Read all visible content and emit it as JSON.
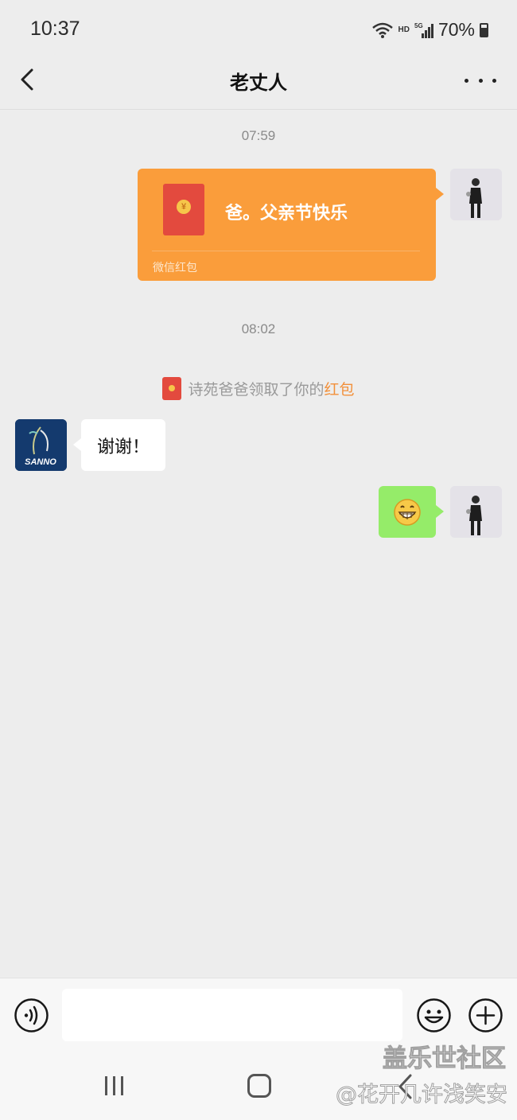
{
  "status_bar": {
    "time": "10:37",
    "network": "HD",
    "signal": "5G",
    "battery": "70%"
  },
  "header": {
    "title": "老丈人"
  },
  "messages": {
    "time_1": "07:59",
    "red_packet": {
      "message": "爸。父亲节快乐",
      "label": "微信红包",
      "coin_symbol": "¥"
    },
    "time_2": "08:02",
    "system_notice": {
      "text": "诗苑爸爸领取了你的",
      "link": "红包"
    },
    "reply_text": "谢谢！",
    "avatar_other_logo": "SANNO"
  },
  "input_bar": {
    "placeholder": ""
  },
  "watermark": {
    "title": "盖乐世社区",
    "user": "@花开几许浅笑安"
  },
  "colors": {
    "background": "#ededed",
    "red_packet": "#fa9d3b",
    "sent_bubble": "#95ec69",
    "link": "#f2903a"
  },
  "icons": [
    "back-icon",
    "more-icon",
    "voice-icon",
    "emoji-icon",
    "plus-icon",
    "wifi-icon",
    "signal-icon",
    "battery-icon"
  ]
}
